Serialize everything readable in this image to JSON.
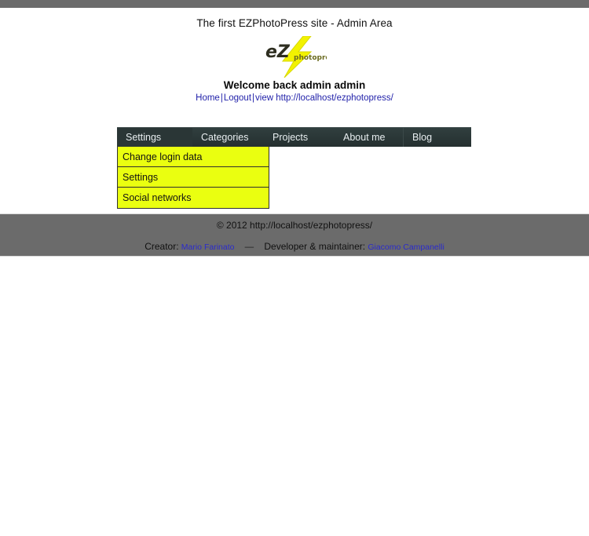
{
  "site": {
    "title": "The first EZPhotoPress site - Admin Area",
    "logo_alt": "ezphotopress-logo",
    "logo_text_ez": "eZ",
    "logo_text_sub": "photopress"
  },
  "header": {
    "welcome": "Welcome back admin admin",
    "links": [
      {
        "label": "Home",
        "name": "home-link"
      },
      {
        "label": "Logout",
        "name": "logout-link"
      },
      {
        "label": "view http://localhost/ezphotopress/",
        "name": "view-site-link"
      }
    ],
    "separator": "|"
  },
  "nav": {
    "items": [
      {
        "label": "Settings",
        "name": "nav-settings",
        "active": true
      },
      {
        "label": "Categories",
        "name": "nav-categories",
        "active": false
      },
      {
        "label": "Projects",
        "name": "nav-projects",
        "active": false
      },
      {
        "label": "About me",
        "name": "nav-about-me",
        "active": false
      },
      {
        "label": "Blog",
        "name": "nav-blog",
        "active": false
      }
    ]
  },
  "dropdown": {
    "parent": "Settings",
    "items": [
      {
        "label": "Change login data",
        "name": "menu-change-login-data"
      },
      {
        "label": "Settings",
        "name": "menu-settings"
      },
      {
        "label": "Social networks",
        "name": "menu-social-networks"
      }
    ]
  },
  "footer": {
    "copyright": "© 2012 http://localhost/ezphotopress/",
    "creator_label": "Creator:",
    "creator_name": "Mario Farinato",
    "dash": "—",
    "developer_label": "Developer & maintainer:",
    "developer_name": "Giacomo Campanelli"
  },
  "colors": {
    "chrome_gray": "#6b6b6b",
    "nav_dark": "#2b3838",
    "menu_yellow": "#eaff10",
    "link_blue": "#2222aa"
  }
}
